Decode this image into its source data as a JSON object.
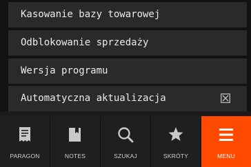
{
  "menu": {
    "items": [
      {
        "label": "Kasowanie bazy towarowej"
      },
      {
        "label": "Odblokowanie sprzedaży"
      },
      {
        "label": "Wersja programu"
      },
      {
        "label": "Automatyczna aktualizacja",
        "checkbox_checked": true
      }
    ]
  },
  "tabbar": {
    "tabs": [
      {
        "label": "PARAGON",
        "icon": "receipt-icon"
      },
      {
        "label": "NOTES",
        "icon": "notebook-icon"
      },
      {
        "label": "SZUKAJ",
        "icon": "search-icon"
      },
      {
        "label": "SKRÓTY",
        "icon": "star-icon"
      },
      {
        "label": "MENU",
        "icon": "hamburger-menu-icon",
        "active": true
      }
    ]
  },
  "colors": {
    "accent": "#ff4a00",
    "item_background": "#2a2a2a",
    "tabbar_background": "#1f1f1f",
    "text": "#ececec"
  }
}
